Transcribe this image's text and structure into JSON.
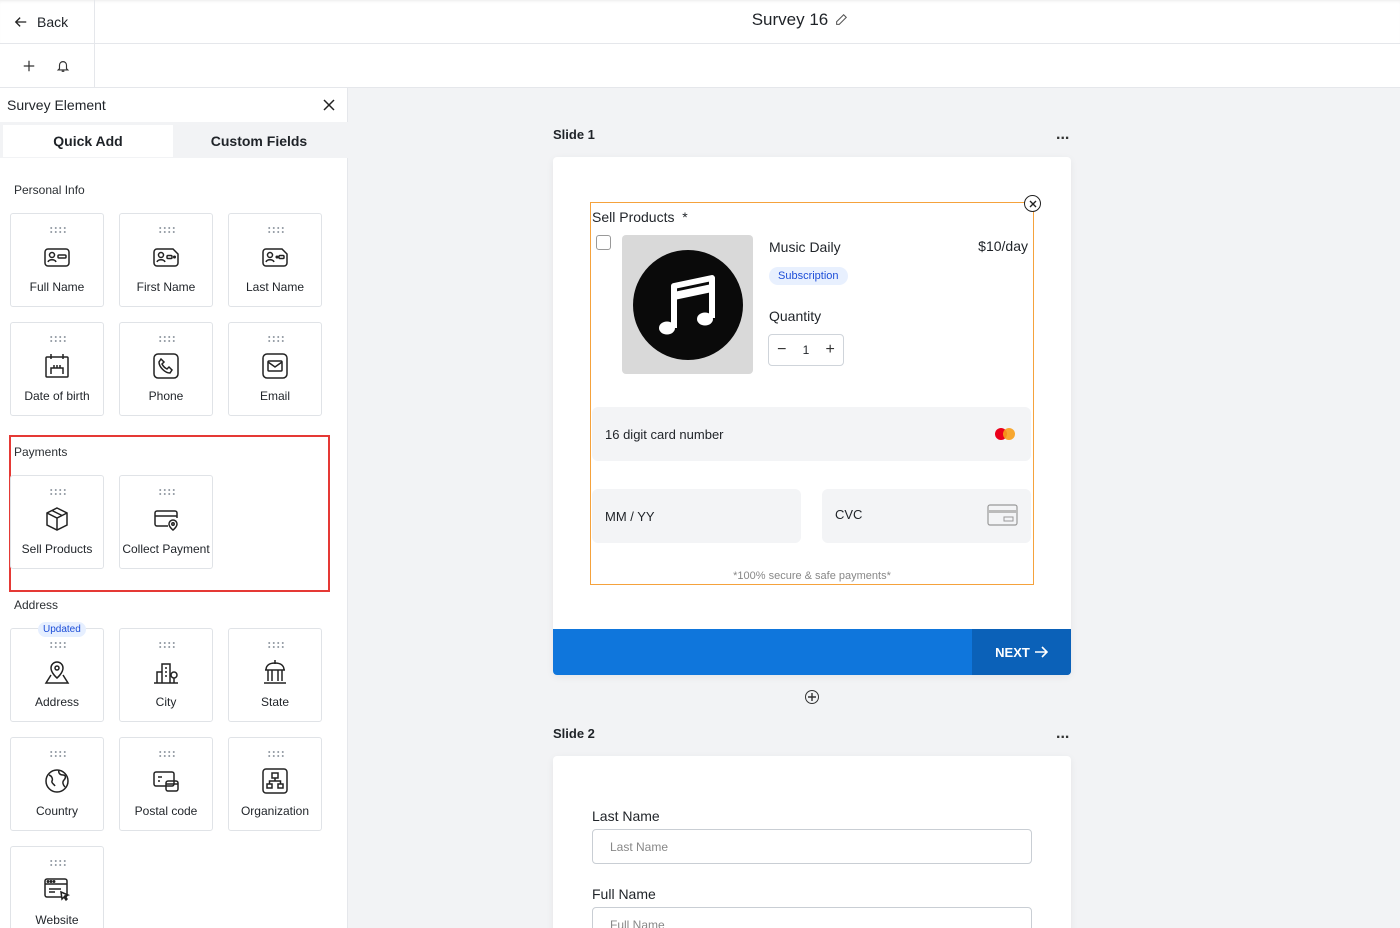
{
  "header": {
    "back_label": "Back",
    "title": "Survey 16"
  },
  "sidebar": {
    "title": "Survey Element",
    "tabs": [
      "Quick Add",
      "Custom Fields"
    ],
    "sections": {
      "personal_info": {
        "label": "Personal Info",
        "items": [
          "Full Name",
          "First Name",
          "Last Name",
          "Date of birth",
          "Phone",
          "Email"
        ]
      },
      "payments": {
        "label": "Payments",
        "items": [
          "Sell Products",
          "Collect Payment"
        ]
      },
      "address": {
        "label": "Address",
        "badge": "Updated",
        "items": [
          "Address",
          "City",
          "State",
          "Country",
          "Postal code",
          "Organization",
          "Website"
        ]
      }
    }
  },
  "canvas": {
    "slide1": {
      "label": "Slide 1",
      "menu": "...",
      "element_title": "Sell Products",
      "required_mark": "*",
      "product_name": "Music Daily",
      "product_price": "$10/day",
      "product_type": "Subscription",
      "quantity_label": "Quantity",
      "quantity_value": "1",
      "card_number_placeholder": "16 digit card number",
      "expiry_placeholder": "MM / YY",
      "cvc_placeholder": "CVC",
      "secure_note": "*100% secure & safe payments*",
      "next_label": "NEXT"
    },
    "slide2": {
      "label": "Slide 2",
      "menu": "...",
      "fields": [
        {
          "label": "Last Name",
          "placeholder": "Last Name"
        },
        {
          "label": "Full Name",
          "placeholder": "Full Name"
        }
      ]
    }
  },
  "colors": {
    "primary_blue": "#0f76dc",
    "next_button": "#0b61b8",
    "highlight_red": "#e53935",
    "selected_orange": "#f5a23c",
    "badge_blue": "#1d4ed8"
  },
  "icons": [
    "arrow-left-icon",
    "pencil-icon",
    "plus-icon",
    "bell-icon",
    "close-icon",
    "id-card-icon",
    "calendar-cake-icon",
    "phone-icon",
    "email-icon",
    "box-icon",
    "card-pin-icon",
    "location-pin-icon",
    "city-icon",
    "capitol-icon",
    "globe-icon",
    "postal-icon",
    "organization-icon",
    "website-icon",
    "music-note-icon",
    "mastercard-icon",
    "card-icon"
  ]
}
